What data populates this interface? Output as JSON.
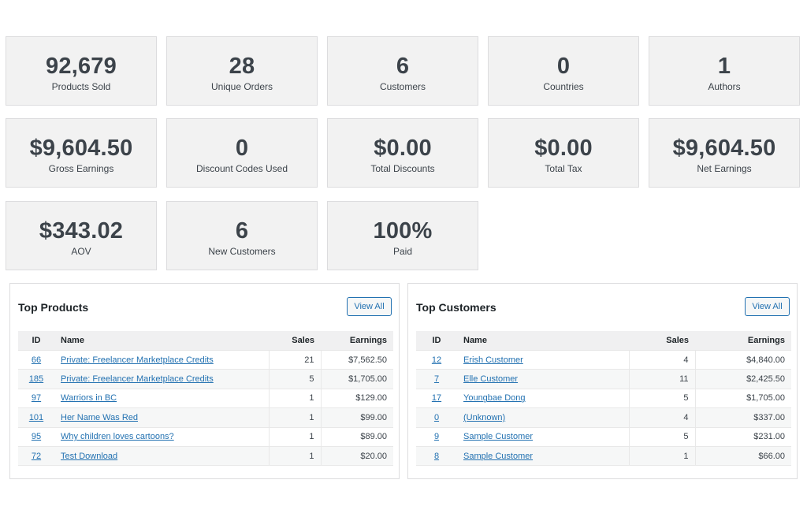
{
  "stats": [
    {
      "value": "92,679",
      "label": "Products Sold"
    },
    {
      "value": "28",
      "label": "Unique Orders"
    },
    {
      "value": "6",
      "label": "Customers"
    },
    {
      "value": "0",
      "label": "Countries"
    },
    {
      "value": "1",
      "label": "Authors"
    },
    {
      "value": "$9,604.50",
      "label": "Gross Earnings"
    },
    {
      "value": "0",
      "label": "Discount Codes Used"
    },
    {
      "value": "$0.00",
      "label": "Total Discounts"
    },
    {
      "value": "$0.00",
      "label": "Total Tax"
    },
    {
      "value": "$9,604.50",
      "label": "Net Earnings"
    },
    {
      "value": "$343.02",
      "label": "AOV"
    },
    {
      "value": "6",
      "label": "New Customers"
    },
    {
      "value": "100%",
      "label": "Paid"
    }
  ],
  "top_products": {
    "title": "Top Products",
    "view_all": "View All",
    "columns": [
      "ID",
      "Name",
      "Sales",
      "Earnings"
    ],
    "rows": [
      {
        "id": "66",
        "name": "Private: Freelancer Marketplace Credits",
        "sales": "21",
        "earnings": "$7,562.50"
      },
      {
        "id": "185",
        "name": "Private: Freelancer Marketplace Credits",
        "sales": "5",
        "earnings": "$1,705.00"
      },
      {
        "id": "97",
        "name": "Warriors in BC",
        "sales": "1",
        "earnings": "$129.00"
      },
      {
        "id": "101",
        "name": "Her Name Was Red",
        "sales": "1",
        "earnings": "$99.00"
      },
      {
        "id": "95",
        "name": "Why children loves cartoons?",
        "sales": "1",
        "earnings": "$89.00"
      },
      {
        "id": "72",
        "name": "Test Download",
        "sales": "1",
        "earnings": "$20.00"
      }
    ]
  },
  "top_customers": {
    "title": "Top Customers",
    "view_all": "View All",
    "columns": [
      "ID",
      "Name",
      "Sales",
      "Earnings"
    ],
    "rows": [
      {
        "id": "12",
        "name": "Erish Customer",
        "sales": "4",
        "earnings": "$4,840.00"
      },
      {
        "id": "7",
        "name": "Elle Customer",
        "sales": "11",
        "earnings": "$2,425.50"
      },
      {
        "id": "17",
        "name": "Youngbae Dong",
        "sales": "5",
        "earnings": "$1,705.00"
      },
      {
        "id": "0",
        "name": "(Unknown)",
        "sales": "4",
        "earnings": "$337.00"
      },
      {
        "id": "9",
        "name": "Sample Customer",
        "sales": "5",
        "earnings": "$231.00"
      },
      {
        "id": "8",
        "name": "Sample Customer",
        "sales": "1",
        "earnings": "$66.00"
      }
    ]
  }
}
